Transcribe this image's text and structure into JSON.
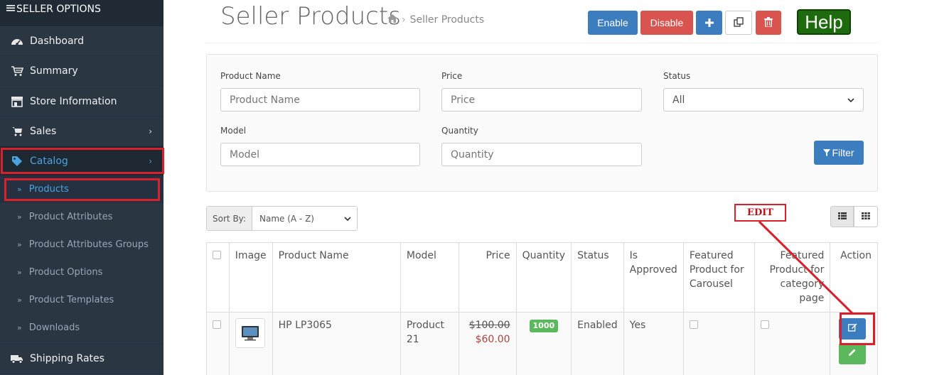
{
  "sidebar": {
    "header": "SELLER OPTIONS",
    "items": [
      {
        "label": "Dashboard",
        "icon": "dashboard-icon"
      },
      {
        "label": "Summary",
        "icon": "cart-icon"
      },
      {
        "label": "Store Information",
        "icon": "store-icon"
      },
      {
        "label": "Sales",
        "icon": "shopping-cart-icon"
      },
      {
        "label": "Catalog",
        "icon": "tag-icon"
      },
      {
        "label": "Shipping Rates",
        "icon": "truck-icon"
      }
    ],
    "submenu": [
      {
        "label": "Products"
      },
      {
        "label": "Product Attributes"
      },
      {
        "label": "Product Attributes Groups"
      },
      {
        "label": "Product Options"
      },
      {
        "label": "Product Templates"
      },
      {
        "label": "Downloads"
      }
    ]
  },
  "header": {
    "title": "Seller Products",
    "breadcrumb": "Seller Products",
    "buttons": {
      "enable": "Enable",
      "disable": "Disable",
      "help": "Help"
    }
  },
  "filter": {
    "product_name_label": "Product Name",
    "product_name_placeholder": "Product Name",
    "price_label": "Price",
    "price_placeholder": "Price",
    "status_label": "Status",
    "status_value": "All",
    "model_label": "Model",
    "model_placeholder": "Model",
    "quantity_label": "Quantity",
    "quantity_placeholder": "Quantity",
    "filter_button": "Filter"
  },
  "sort": {
    "label": "Sort By:",
    "value": "Name (A - Z)"
  },
  "annotation": {
    "edit": "EDIT"
  },
  "table": {
    "headers": {
      "image": "Image",
      "name": "Product Name",
      "model": "Model",
      "price": "Price",
      "quantity": "Quantity",
      "status": "Status",
      "approved": "Is Approved",
      "featured_carousel": "Featured Product for Carousel",
      "featured_category": "Featured Product for category page",
      "action": "Action"
    },
    "rows": [
      {
        "name": "HP LP3065",
        "model": "Product 21",
        "price_old": "$100.00",
        "price_new": "$60.00",
        "quantity": "1000",
        "status": "Enabled",
        "approved": "Yes"
      }
    ]
  },
  "colors": {
    "sidebar_bg": "#2b3643",
    "accent_blue": "#3c7dbf",
    "danger": "#d9534f",
    "success": "#5cb85c",
    "help_green": "#1e6b0d",
    "highlight_red": "#d9212b"
  }
}
